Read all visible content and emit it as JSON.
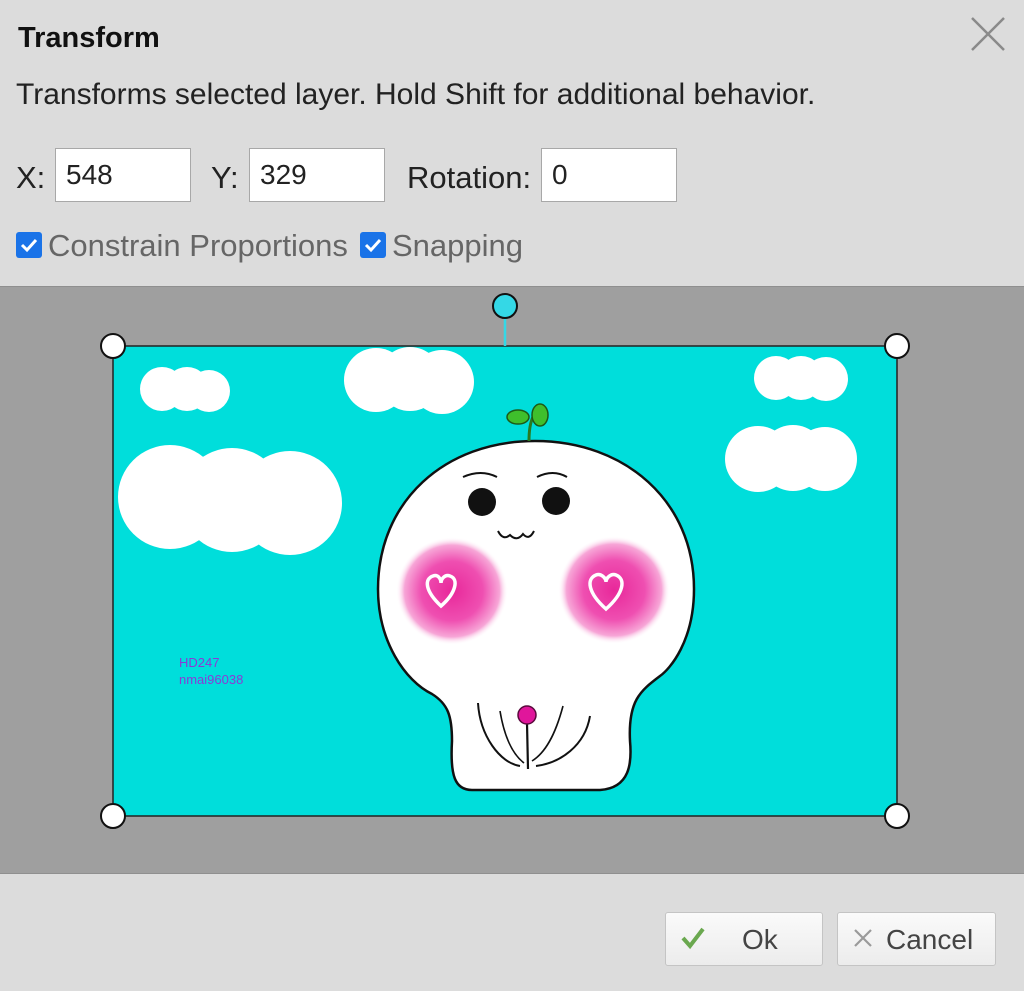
{
  "dialog": {
    "title": "Transform",
    "description": "Transforms selected layer. Hold Shift for additional behavior."
  },
  "fields": {
    "x_label": "X:",
    "x_value": "548",
    "y_label": "Y:",
    "y_value": "329",
    "rotation_label": "Rotation:",
    "rotation_value": "0"
  },
  "options": {
    "constrain_label": "Constrain Proportions",
    "constrain_checked": true,
    "snapping_label": "Snapping",
    "snapping_checked": true
  },
  "preview": {
    "watermark_line1": "HD247",
    "watermark_line2": "nmai96038",
    "background_color": "#00dedb",
    "handle_accent": "#34d8e6"
  },
  "buttons": {
    "ok_label": "Ok",
    "cancel_label": "Cancel"
  },
  "icons": {
    "close": "close-icon",
    "ok": "checkmark-icon",
    "cancel": "x-icon"
  }
}
